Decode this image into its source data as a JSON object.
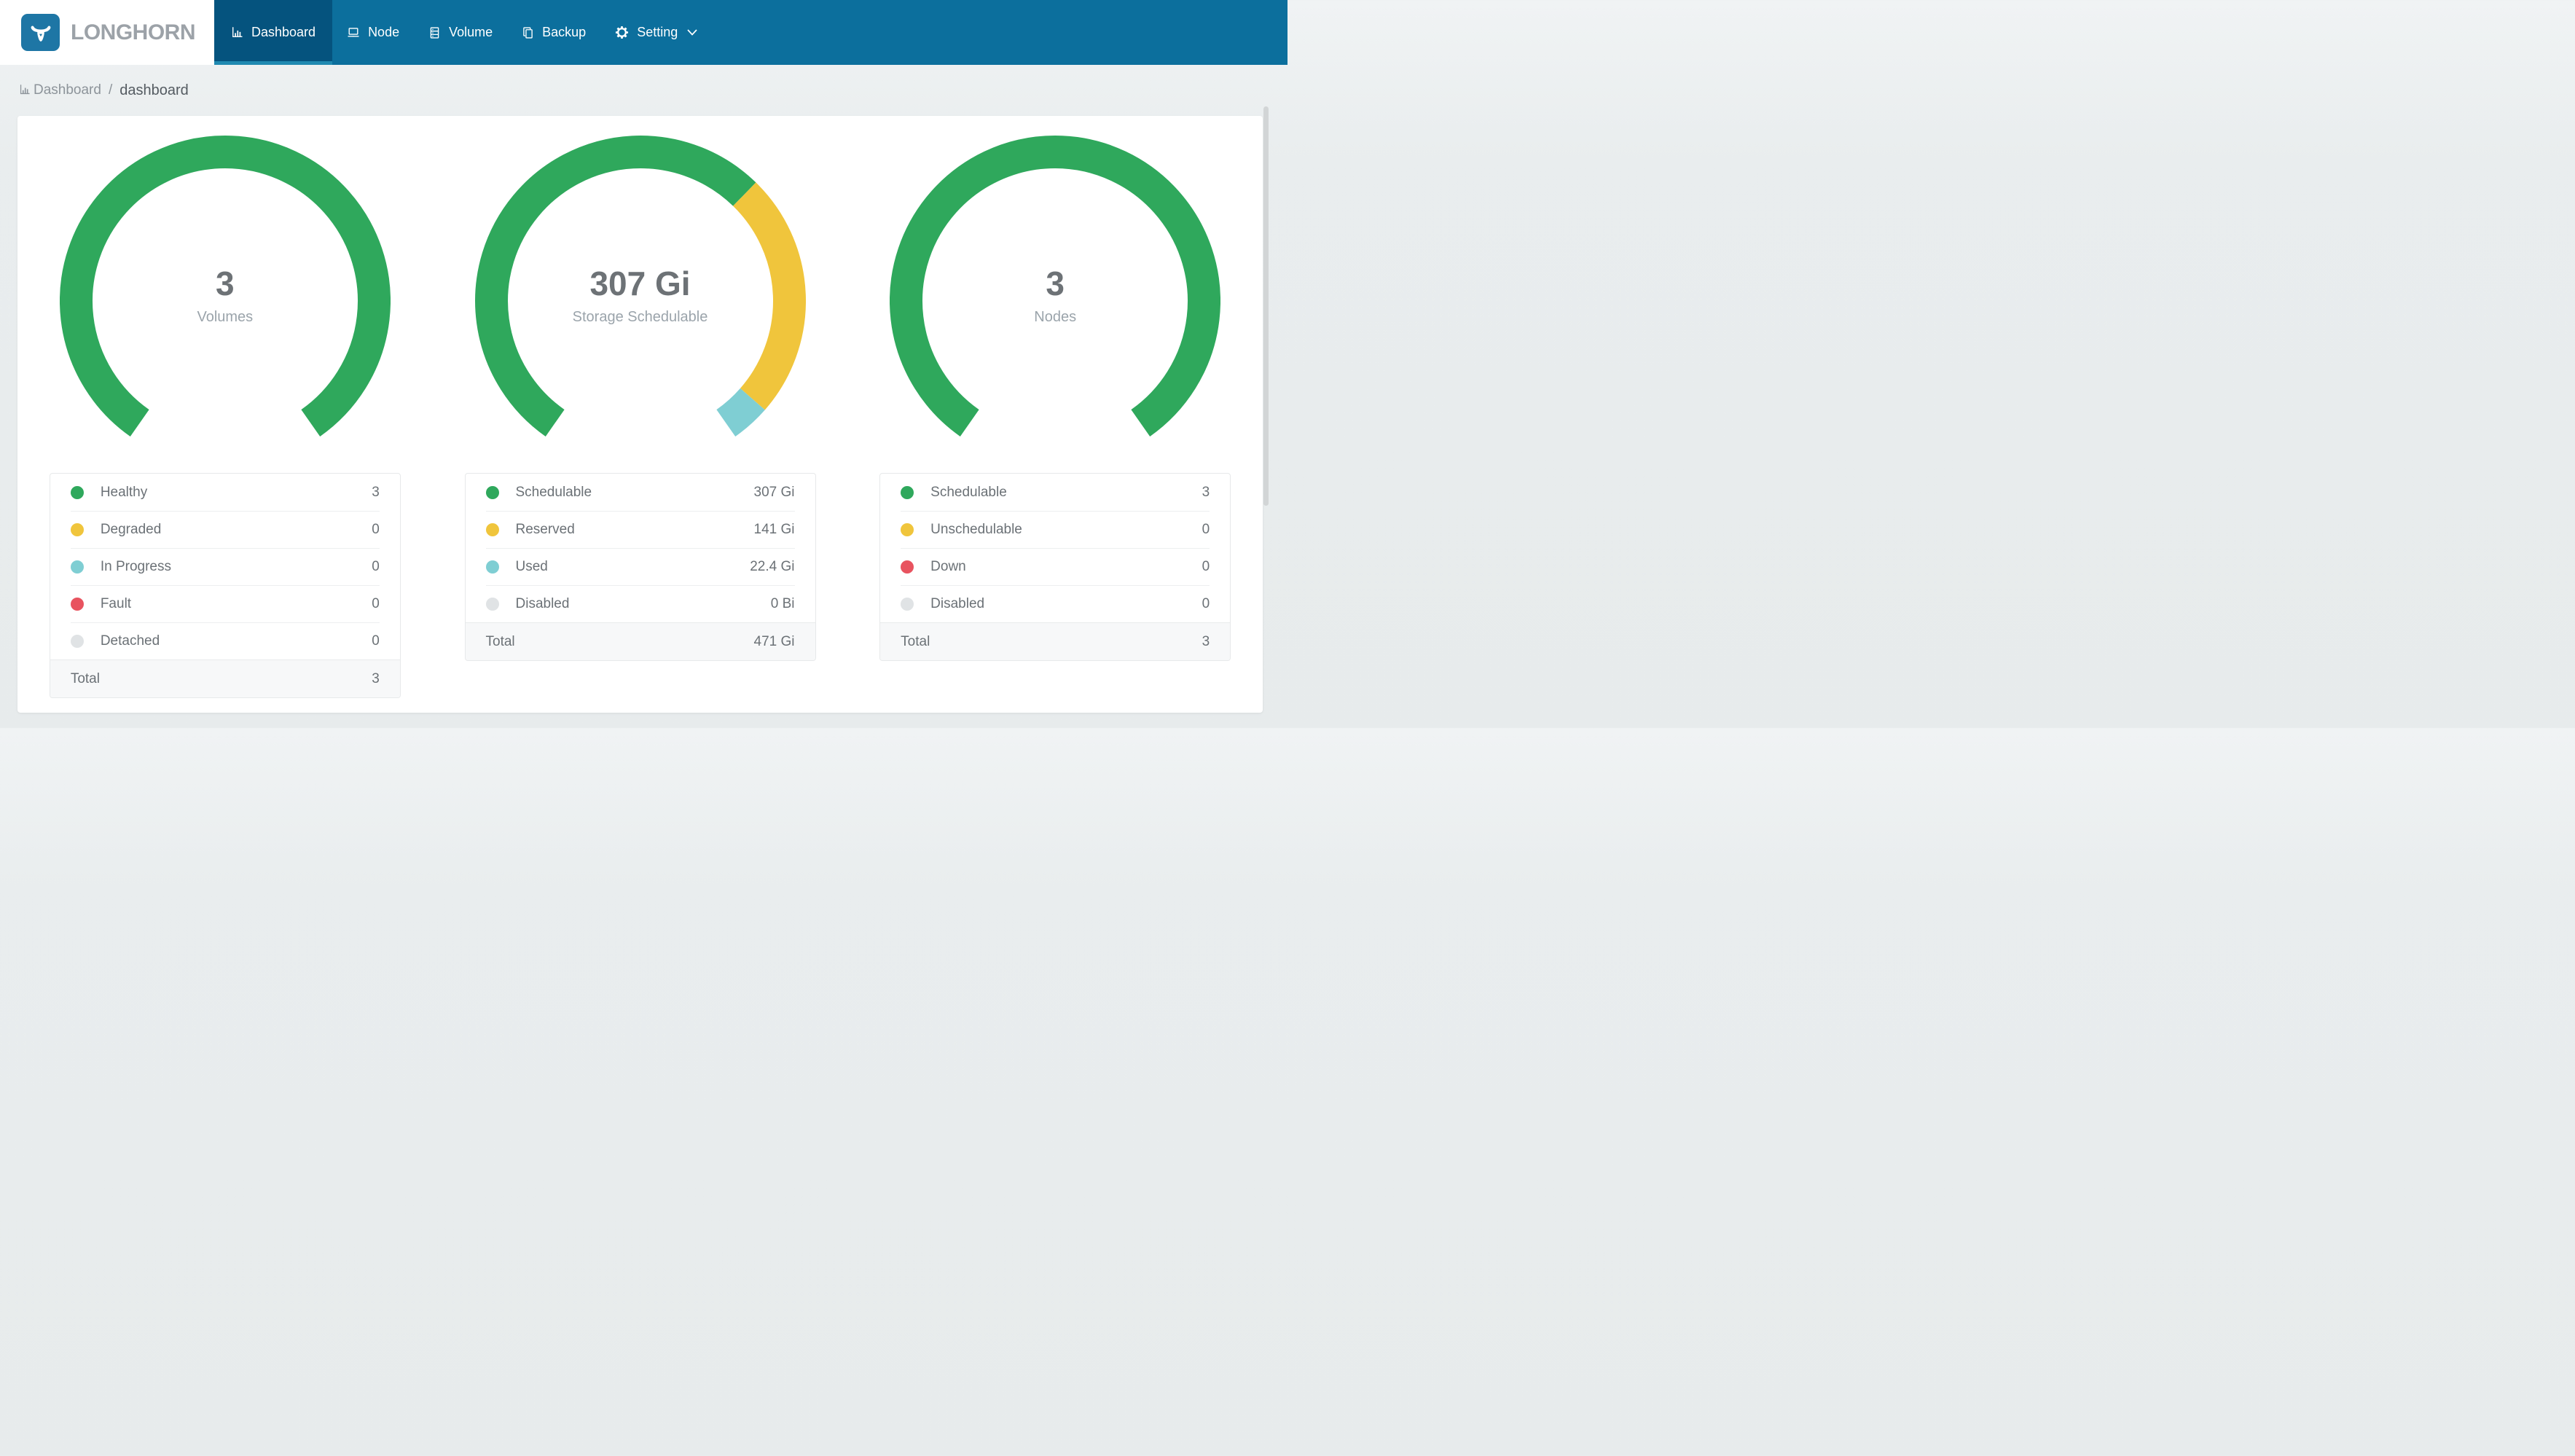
{
  "brand": {
    "name": "LONGHORN"
  },
  "nav": {
    "items": [
      {
        "label": "Dashboard",
        "icon": "bar-chart-icon",
        "active": true
      },
      {
        "label": "Node",
        "icon": "laptop-icon",
        "active": false
      },
      {
        "label": "Volume",
        "icon": "database-icon",
        "active": false
      },
      {
        "label": "Backup",
        "icon": "copy-icon",
        "active": false
      },
      {
        "label": "Setting",
        "icon": "gear-icon",
        "active": false,
        "dropdown": true
      }
    ]
  },
  "breadcrumb": {
    "section": "Dashboard",
    "separator": "/",
    "current": "dashboard"
  },
  "colors": {
    "nav_bg": "#0c6f9d",
    "nav_active_bg": "#05537e",
    "nav_active_underline": "#2089b1",
    "logo_blue": "#1e76a5",
    "green": "#2fa85c",
    "yellow": "#f0c53c",
    "teal": "#7fced3",
    "red": "#e8535f",
    "gray": "#e0e3e5"
  },
  "chart_data": [
    {
      "type": "donut-gauge",
      "name": "volumes",
      "center_value": "3",
      "center_label": "Volumes",
      "arc_degrees": 290,
      "start_angle": 215,
      "segments": [
        {
          "label": "Healthy",
          "value": 3,
          "display": "3",
          "color": "#2fa85c"
        },
        {
          "label": "Degraded",
          "value": 0,
          "display": "0",
          "color": "#f0c53c"
        },
        {
          "label": "In Progress",
          "value": 0,
          "display": "0",
          "color": "#7fced3"
        },
        {
          "label": "Fault",
          "value": 0,
          "display": "0",
          "color": "#e8535f"
        },
        {
          "label": "Detached",
          "value": 0,
          "display": "0",
          "color": "#e0e3e5"
        }
      ],
      "total": {
        "label": "Total",
        "value": 3,
        "display": "3"
      }
    },
    {
      "type": "donut-gauge",
      "name": "storage-schedulable",
      "center_value": "307 Gi",
      "center_label": "Storage Schedulable",
      "arc_degrees": 290,
      "start_angle": 215,
      "segments": [
        {
          "label": "Schedulable",
          "value": 307,
          "display": "307 Gi",
          "color": "#2fa85c"
        },
        {
          "label": "Reserved",
          "value": 141,
          "display": "141 Gi",
          "color": "#f0c53c"
        },
        {
          "label": "Used",
          "value": 22.4,
          "display": "22.4 Gi",
          "color": "#7fced3"
        },
        {
          "label": "Disabled",
          "value": 0,
          "display": "0 Bi",
          "color": "#e0e3e5"
        }
      ],
      "total": {
        "label": "Total",
        "value": 471,
        "display": "471 Gi"
      }
    },
    {
      "type": "donut-gauge",
      "name": "nodes",
      "center_value": "3",
      "center_label": "Nodes",
      "arc_degrees": 290,
      "start_angle": 215,
      "segments": [
        {
          "label": "Schedulable",
          "value": 3,
          "display": "3",
          "color": "#2fa85c"
        },
        {
          "label": "Unschedulable",
          "value": 0,
          "display": "0",
          "color": "#f0c53c"
        },
        {
          "label": "Down",
          "value": 0,
          "display": "0",
          "color": "#e8535f"
        },
        {
          "label": "Disabled",
          "value": 0,
          "display": "0",
          "color": "#e0e3e5"
        }
      ],
      "total": {
        "label": "Total",
        "value": 3,
        "display": "3"
      }
    }
  ]
}
